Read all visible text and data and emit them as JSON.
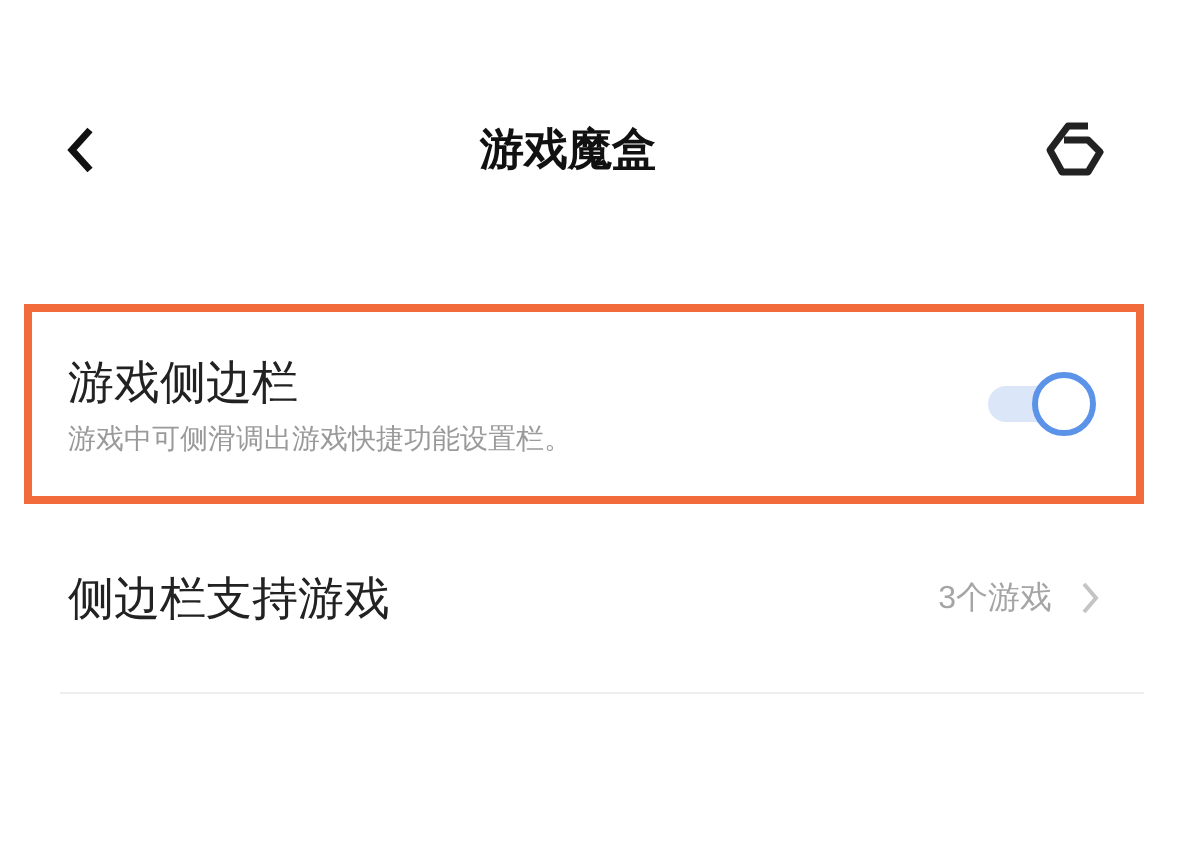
{
  "header": {
    "title": "游戏魔盒"
  },
  "settings": [
    {
      "kind": "toggle",
      "label": "游戏侧边栏",
      "description": "游戏中可侧滑调出游戏快捷功能设置栏。",
      "on": true,
      "highlighted": true
    },
    {
      "kind": "link",
      "label": "侧边栏支持游戏",
      "value": "3个游戏",
      "highlighted": false
    }
  ]
}
